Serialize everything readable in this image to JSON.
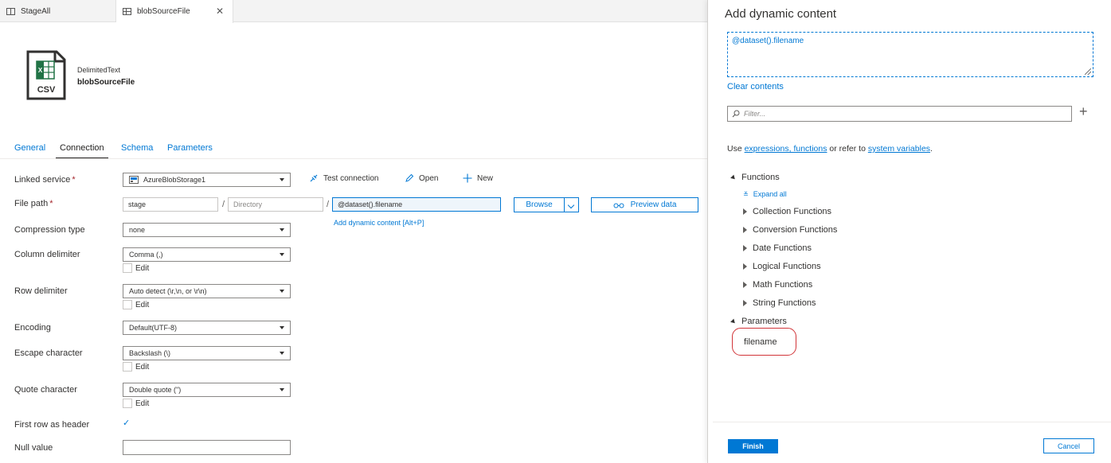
{
  "tabs": [
    {
      "label": "StageAll"
    },
    {
      "label": "blobSourceFile"
    }
  ],
  "dataset": {
    "icon_label": "CSV",
    "type": "DelimitedText",
    "name": "blobSourceFile"
  },
  "section_tabs": [
    "General",
    "Connection",
    "Schema",
    "Parameters"
  ],
  "form": {
    "linked_service": {
      "label": "Linked service",
      "value": "AzureBlobStorage1"
    },
    "file_path": {
      "label": "File path",
      "container": "stage",
      "directory_placeholder": "Directory",
      "file": "@dataset().filename",
      "add_dynamic": "Add dynamic content [Alt+P]"
    },
    "compression": {
      "label": "Compression type",
      "value": "none"
    },
    "column_delimiter": {
      "label": "Column delimiter",
      "value": "Comma (,)",
      "edit": "Edit"
    },
    "row_delimiter": {
      "label": "Row delimiter",
      "value": "Auto detect (\\r,\\n, or \\r\\n)",
      "edit": "Edit"
    },
    "encoding": {
      "label": "Encoding",
      "value": "Default(UTF-8)"
    },
    "escape": {
      "label": "Escape character",
      "value": "Backslash (\\)",
      "edit": "Edit"
    },
    "quote": {
      "label": "Quote character",
      "value": "Double quote (\")",
      "edit": "Edit"
    },
    "first_row": {
      "label": "First row as header",
      "checked": true
    },
    "null_value": {
      "label": "Null value",
      "value": ""
    }
  },
  "toolbar": {
    "test_connection": "Test connection",
    "open": "Open",
    "new": "New",
    "browse": "Browse",
    "preview": "Preview data"
  },
  "panel": {
    "title": "Add dynamic content",
    "expression": "@dataset().filename",
    "clear": "Clear contents",
    "filter_placeholder": "Filter...",
    "use_prefix": "Use ",
    "use_link1": "expressions, functions",
    "use_middle": " or refer to ",
    "use_link2": "system variables",
    "use_suffix": ".",
    "functions_header": "Functions",
    "expand_all": "Expand all",
    "function_groups": [
      "Collection Functions",
      "Conversion Functions",
      "Date Functions",
      "Logical Functions",
      "Math Functions",
      "String Functions"
    ],
    "parameters_header": "Parameters",
    "parameters": [
      "filename"
    ],
    "finish": "Finish",
    "cancel": "Cancel"
  },
  "colors": {
    "accent": "#0078d4",
    "highlight_ring": "#d13438",
    "required": "#a4262c",
    "csv_green": "#217346"
  }
}
